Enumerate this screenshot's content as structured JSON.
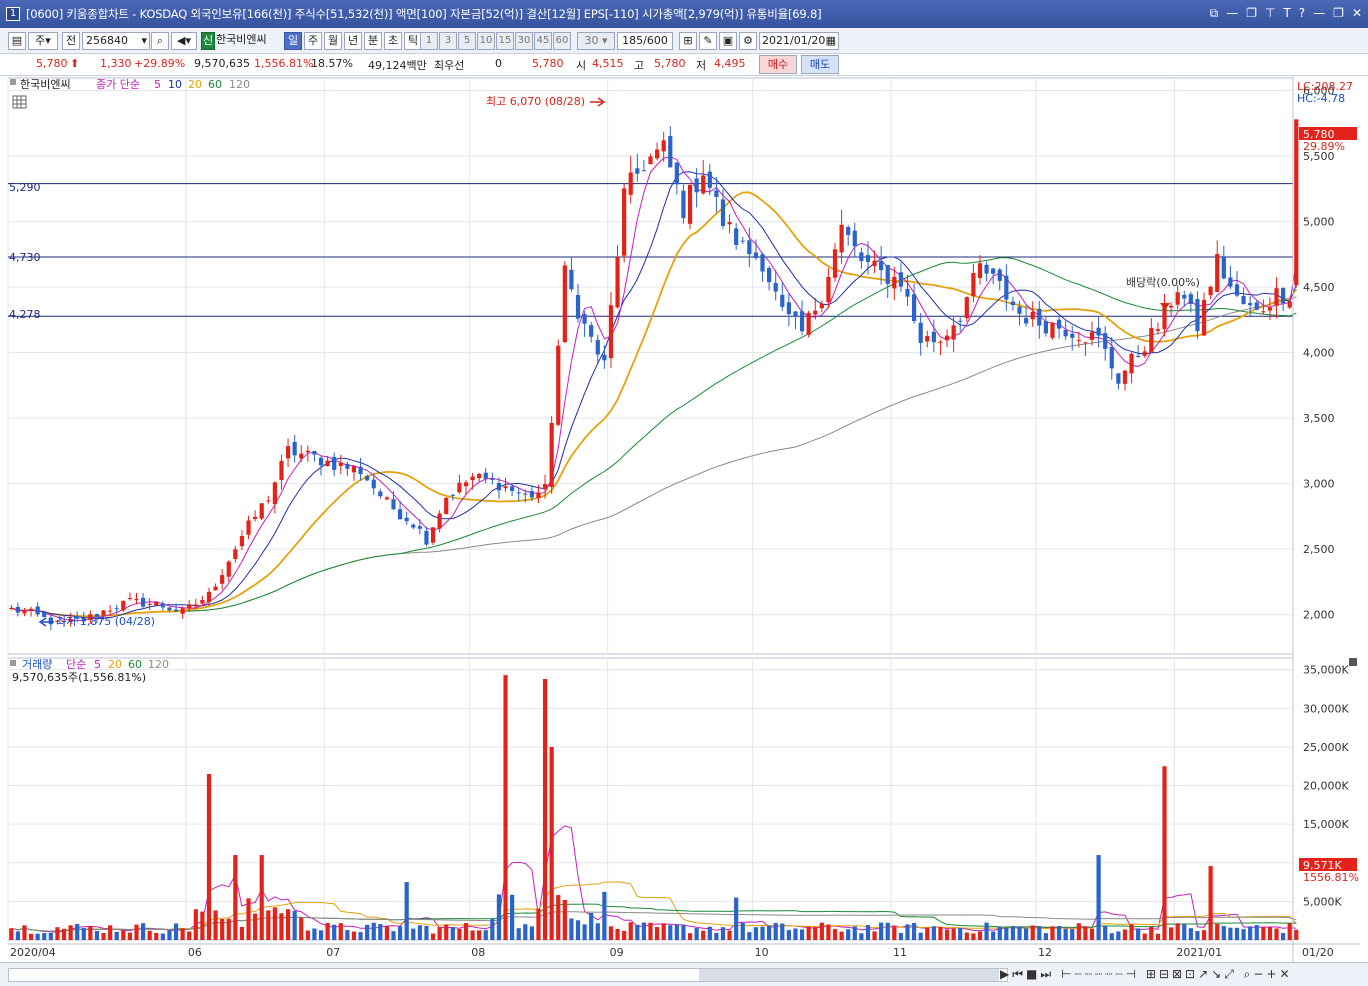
{
  "window": {
    "number": "1",
    "title": "[0600] 키움종합차트 - KOSDAQ 외국인보유[166(천)] 주식수[51,532(천)] 액면[100] 자본금[52(억)] 결산[12월] EPS[-110] 시가총액[2,979(억)] 유통비율[69.8]",
    "controls": [
      "⧉",
      "—",
      "❐",
      "⊤",
      "T",
      "?",
      "—",
      "❐",
      "✕"
    ]
  },
  "toolbar": {
    "period_type": "주",
    "prev_label": "전",
    "code": "256840",
    "stock_badge": "신",
    "stock_name": "한국비엔씨",
    "period_buttons": [
      "일",
      "주",
      "월",
      "년",
      "분",
      "초",
      "틱"
    ],
    "selected_period": "일",
    "interval_buttons": [
      "1",
      "3",
      "5",
      "10",
      "15",
      "30",
      "45",
      "60"
    ],
    "interval_value": "30",
    "count": "185",
    "count_total": "/600",
    "date": "2021/01/20"
  },
  "quote": {
    "price": "5,780",
    "change": "1,330",
    "change_pct": "+29.89%",
    "volume": "9,570,635",
    "volume_ratio": "1,556.81%",
    "turnover": "18.57%",
    "amount": "49,124백만",
    "priority_label": "최우선",
    "priority_value": "0",
    "priority_price": "5,780",
    "open_label": "시",
    "open": "4,515",
    "high_label": "고",
    "high": "5,780",
    "low_label": "저",
    "low": "4,495",
    "buy_label": "매수",
    "sell_label": "매도"
  },
  "price_panel": {
    "legend_name": "한국비엔씨",
    "legend_ma_label": "종가 단순",
    "ma_periods": [
      "5",
      "10",
      "20",
      "60",
      "120"
    ],
    "ma_colors": [
      "#c21fbf",
      "#1f2fa8",
      "#e5a20e",
      "#1a8a33",
      "#8a8a8a"
    ],
    "lc": "LC:208.27",
    "hc": "HC:-4.78",
    "hlines": [
      "5,290",
      "4,730",
      "4,278"
    ],
    "high_note": "최고 6,070 (08/28)",
    "low_note": "최저 1,875 (04/28)",
    "dividend_note": "배당락(0.00%)",
    "last_price_tag": "5,780",
    "last_pct_tag": "29.89%"
  },
  "volume_panel": {
    "legend_name": "거래량",
    "legend_ma_label": "단순",
    "ma_periods": [
      "5",
      "20",
      "60",
      "120"
    ],
    "value_text": "9,570,635주(1,556.81%)",
    "last_tag": "9,571K",
    "last_pct": "1556.81%"
  },
  "chart_data": {
    "type": "candlestick",
    "price_axis": {
      "min": 1700,
      "max": 6050,
      "ticks": [
        "2,000",
        "2,500",
        "3,000",
        "3,500",
        "4,000",
        "4,500",
        "5,000",
        "5,500",
        "6,000"
      ]
    },
    "volume_axis": {
      "max_k": 36000,
      "ticks": [
        "5,000K",
        "10,000K",
        "15,000K",
        "20,000K",
        "25,000K",
        "30,000K",
        "35,000K"
      ]
    },
    "x_labels": [
      "2020/04",
      "06",
      "07",
      "08",
      "09",
      "10",
      "11",
      "12",
      "2021/01",
      "01/20"
    ],
    "anchors": [
      [
        0,
        2040
      ],
      [
        3,
        2010
      ],
      [
        7,
        1930
      ],
      [
        11,
        1960
      ],
      [
        15,
        2050
      ],
      [
        18,
        2100
      ],
      [
        22,
        2080
      ],
      [
        26,
        2020
      ],
      [
        30,
        2150
      ],
      [
        35,
        2600
      ],
      [
        39,
        2900
      ],
      [
        42,
        3250
      ],
      [
        46,
        3200
      ],
      [
        49,
        3150
      ],
      [
        53,
        3100
      ],
      [
        57,
        2850
      ],
      [
        61,
        2700
      ],
      [
        63,
        2580
      ],
      [
        66,
        2900
      ],
      [
        70,
        3050
      ],
      [
        74,
        3000
      ],
      [
        78,
        2900
      ],
      [
        81,
        2950
      ],
      [
        84,
        4600
      ],
      [
        87,
        4200
      ],
      [
        90,
        3900
      ],
      [
        93,
        5200
      ],
      [
        96,
        5450
      ],
      [
        99,
        5550
      ],
      [
        102,
        5100
      ],
      [
        105,
        5400
      ],
      [
        108,
        5000
      ],
      [
        111,
        4800
      ],
      [
        114,
        4700
      ],
      [
        117,
        4300
      ],
      [
        120,
        4150
      ],
      [
        123,
        4450
      ],
      [
        126,
        4950
      ],
      [
        129,
        4700
      ],
      [
        132,
        4600
      ],
      [
        135,
        4550
      ],
      [
        138,
        4100
      ],
      [
        141,
        4100
      ],
      [
        144,
        4300
      ],
      [
        147,
        4650
      ],
      [
        150,
        4500
      ],
      [
        153,
        4300
      ],
      [
        156,
        4230
      ],
      [
        159,
        4200
      ],
      [
        162,
        4150
      ],
      [
        165,
        4100
      ],
      [
        168,
        3800
      ],
      [
        171,
        4000
      ],
      [
        174,
        4200
      ],
      [
        177,
        4500
      ],
      [
        180,
        4200
      ],
      [
        183,
        4700
      ],
      [
        186,
        4400
      ],
      [
        189,
        4300
      ],
      [
        192,
        4450
      ],
      [
        194,
        4450
      ]
    ],
    "last_candle": {
      "open": 4515,
      "high": 5780,
      "low": 4495,
      "close": 5780
    },
    "volume_spikes_k": {
      "30": 21500,
      "34": 11000,
      "38": 11000,
      "60": 7500,
      "75": 34300,
      "81": 33800,
      "82": 25000,
      "110": 5500,
      "165": 11000,
      "175": 22500,
      "182": 9571
    }
  }
}
